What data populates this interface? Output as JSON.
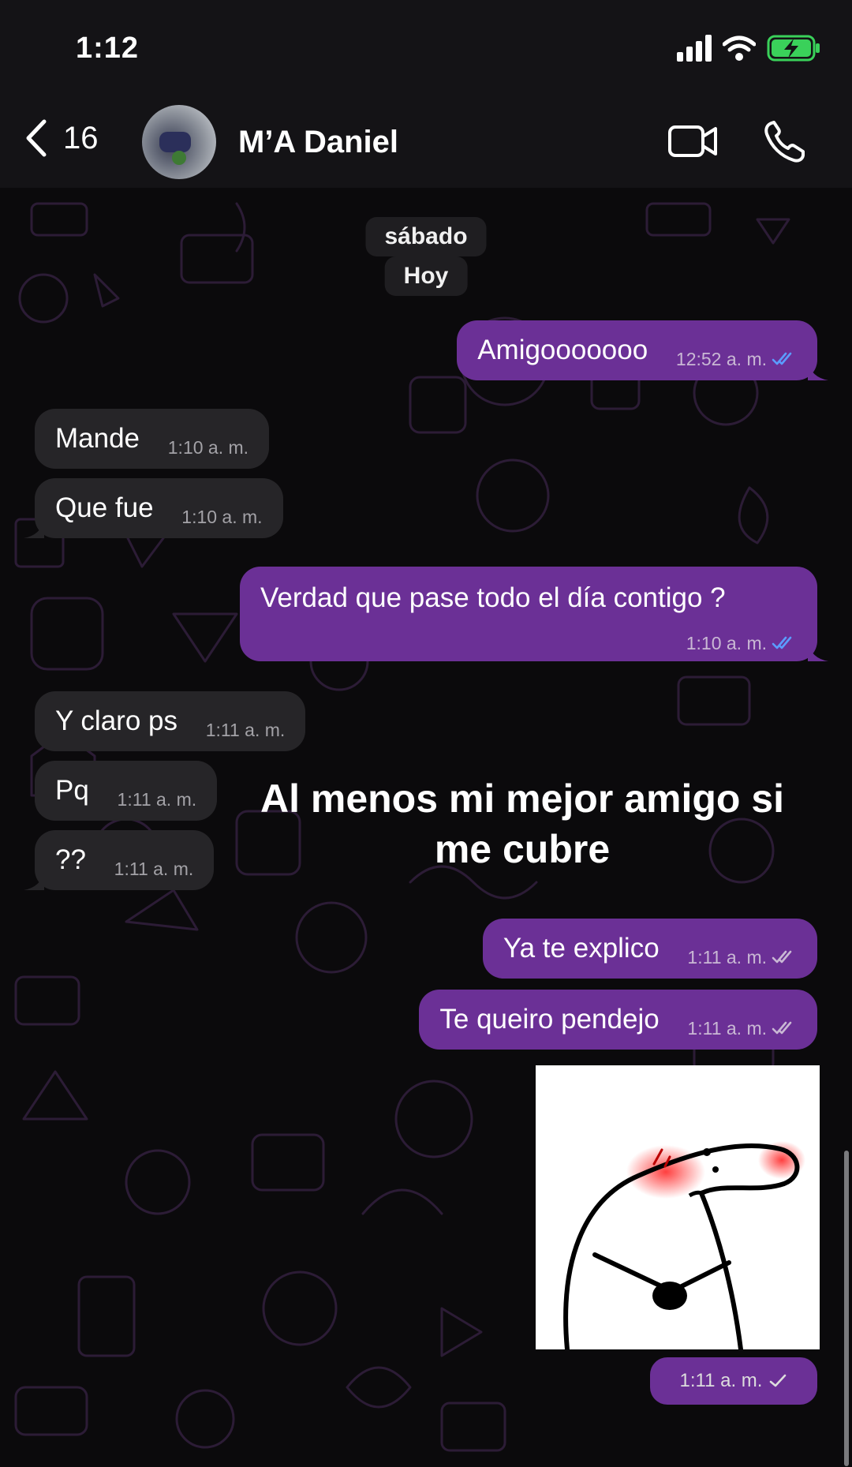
{
  "status": {
    "time": "1:12"
  },
  "header": {
    "back_count": "16",
    "contact_name": "M’A Daniel"
  },
  "date_pills": [
    "sábado",
    "Hoy"
  ],
  "messages": [
    {
      "text": "Amigooooooo",
      "time": "12:52 a. m."
    },
    {
      "text": "Mande",
      "time": "1:10 a. m."
    },
    {
      "text": "Que fue",
      "time": "1:10 a. m."
    },
    {
      "text": "Verdad que pase todo el día contigo ?",
      "time": "1:10 a. m."
    },
    {
      "text": "Y claro ps",
      "time": "1:11 a. m."
    },
    {
      "text": "Pq",
      "time": "1:11 a. m."
    },
    {
      "text": "??",
      "time": "1:11 a. m."
    },
    {
      "text": "Ya te explico",
      "time": "1:11 a. m."
    },
    {
      "text": "Te queiro pendejo",
      "time": "1:11 a. m."
    }
  ],
  "sticker": {
    "time": "1:11 a. m."
  },
  "overlay_caption": [
    "Al menos mi mejor amigo si",
    "me cubre"
  ],
  "colors": {
    "outgoing_bubble": "#6b3096",
    "incoming_bubble": "#262528",
    "read_ticks": "#5b9cff",
    "background": "#0b0a0c",
    "battery": "#3ad15a"
  },
  "icons": [
    "back-chevron-icon",
    "video-call-icon",
    "phone-icon",
    "signal-icon",
    "wifi-icon",
    "battery-charging-icon",
    "double-check-icon",
    "single-check-icon"
  ]
}
